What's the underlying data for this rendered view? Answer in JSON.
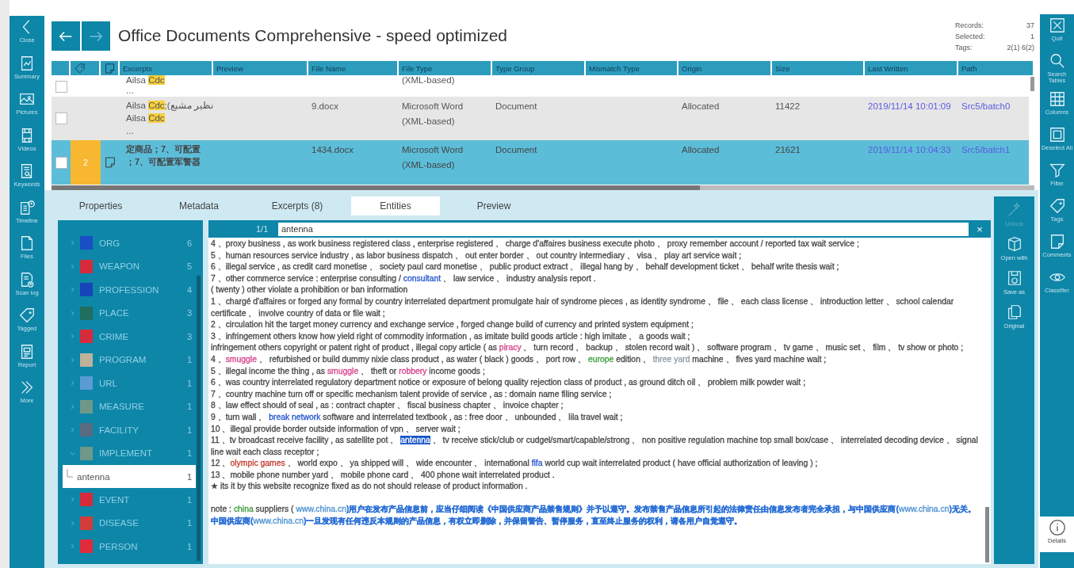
{
  "left_rail": [
    {
      "label": "Close"
    },
    {
      "label": "Summary"
    },
    {
      "label": "Pictures"
    },
    {
      "label": "Videos"
    },
    {
      "label": "Keywords"
    },
    {
      "label": "Timeline"
    },
    {
      "label": "Files"
    },
    {
      "label": "Scan log"
    },
    {
      "label": "Tagged"
    },
    {
      "label": "Report"
    },
    {
      "label": "More"
    }
  ],
  "nav": [
    {
      "kind": "back",
      "disabled": false
    },
    {
      "kind": "forward",
      "disabled": true
    }
  ],
  "title": "Office Documents Comprehensive - speed optimized",
  "stats": [
    {
      "label": "Records:",
      "value": "37"
    },
    {
      "label": "Selected:",
      "value": "1"
    },
    {
      "label": "Tags:",
      "value": "2(1) 6(2)"
    }
  ],
  "table": {
    "columns": [
      "Excerpts",
      "Preview",
      "File Name",
      "File Type",
      "Type Group",
      "Mismatch Type",
      "Origin",
      "Size",
      "Last Written",
      "Path"
    ],
    "rows": [
      {
        "checked": false,
        "selected": false,
        "note": false,
        "excerpt": [
          [
            {
              "text": "Ailsa "
            },
            {
              "text": "Cdc",
              "kind": "hit"
            }
          ],
          [
            {
              "text": "..."
            }
          ]
        ],
        "file_name": "",
        "file_type": "(XML-based)",
        "type_group": "",
        "origin": "",
        "size": "",
        "last_written": "",
        "path": ""
      },
      {
        "checked": false,
        "selected": false,
        "note": false,
        "excerpt": [
          [
            {
              "text": "Ailsa "
            },
            {
              "text": "Cdc",
              "kind": "hit"
            },
            {
              "text": ";(نظیر مشبع"
            }
          ],
          [
            {
              "text": "Ailsa "
            },
            {
              "text": "Cdc",
              "kind": "hit"
            }
          ],
          [
            {
              "text": "..."
            }
          ]
        ],
        "file_name": "9.docx",
        "file_type": "Microsoft Word (XML-based)",
        "type_group": "Document",
        "origin": "Allocated",
        "size": "11422",
        "last_written": "2019/11/14 10:01:09",
        "path": "Src5/batch0"
      },
      {
        "checked": false,
        "selected": true,
        "tag": "2",
        "note": true,
        "excerpt": [
          [
            {
              "text": "定商品；7、可配置"
            }
          ],
          [
            {
              "text": "；7、可配置军警器"
            }
          ]
        ],
        "file_name": "1434.docx",
        "file_type": "Microsoft Word (XML-based)",
        "type_group": "Document",
        "origin": "Allocated",
        "size": "21621",
        "last_written": "2019/11/14 10:04:33",
        "path": "Src5/batch1"
      }
    ]
  },
  "tabs": [
    {
      "label": "Properties",
      "selected": false
    },
    {
      "label": "Metadata",
      "selected": false
    },
    {
      "label": "Excerpts (8)",
      "selected": false
    },
    {
      "label": "Entities",
      "selected": true
    },
    {
      "label": "Preview",
      "selected": false
    }
  ],
  "entities": [
    {
      "name": "ORG",
      "count": "6",
      "color": "#1a4fc4",
      "expanded": false
    },
    {
      "name": "WEAPON",
      "count": "5",
      "color": "#d62b3a",
      "expanded": false
    },
    {
      "name": "PROFESSION",
      "count": "4",
      "color": "#1745b8",
      "expanded": false
    },
    {
      "name": "PLACE",
      "count": "3",
      "color": "#1f6e5e",
      "expanded": false
    },
    {
      "name": "CRIME",
      "count": "3",
      "color": "#d62b3a",
      "expanded": false
    },
    {
      "name": "PROGRAM",
      "count": "1",
      "color": "#bfb29a",
      "expanded": false
    },
    {
      "name": "URL",
      "count": "1",
      "color": "#5b9bd5",
      "expanded": false
    },
    {
      "name": "MEASURE",
      "count": "1",
      "color": "#6f978a",
      "expanded": false
    },
    {
      "name": "FACILITY",
      "count": "1",
      "color": "#5a6a80",
      "expanded": false
    },
    {
      "name": "IMPLEMENT",
      "count": "1",
      "color": "#6f978a",
      "expanded": true,
      "children": [
        {
          "name": "antenna",
          "count": "1",
          "selected": true
        }
      ]
    },
    {
      "name": "EVENT",
      "count": "1",
      "color": "#d62b3a",
      "expanded": false
    },
    {
      "name": "DISEASE",
      "count": "1",
      "color": "#d43b3b",
      "expanded": false
    },
    {
      "name": "PERSON",
      "count": "1",
      "color": "#e02b3a",
      "expanded": false
    }
  ],
  "search": {
    "counter": "1/1",
    "value": "antenna",
    "clear": "×"
  },
  "text_lines": [
    [
      {
        "text": "4 、proxy business , as work business registered class , enterprise registered 、 charge d'affaires business execute photo 、 proxy remember account / reported tax wait service ;"
      }
    ],
    [
      {
        "text": "5 、human resources service industry , as labor business dispatch 、 out enter border 、 out country intermediary 、 visa 、 play art service wait ;"
      }
    ],
    [
      {
        "text": "6 、illegal service , as credit card monetise 、 society paul card monetise 、 public product extract 、 illegal hang by 、 behalf development ticket 、 behalf write thesis wait ;"
      }
    ],
    [
      {
        "text": "7 、other commerce service : enterprise consulting / "
      },
      {
        "text": "consultant",
        "color": "#2255cc"
      },
      {
        "text": " 、 law service 、 industry analysis report ."
      }
    ],
    [
      {
        "text": "( twenty ) other violate a prohibition or ban information"
      }
    ],
    [
      {
        "text": "1 、chargé d'affaires or forged any formal by country interrelated department promulgate hair of syndrome pieces , as identity syndrome 、 file 、 each class license 、 introduction letter 、 school calendar certificate 、 involve country of data or file wait ;"
      }
    ],
    [
      {
        "text": "2 、circulation hit the target money currency and exchange service , forged change build of currency and printed system equipment ;"
      }
    ],
    [
      {
        "text": "3 、infringement others know how yield right of commodity information , as imitate build goods article : high imitate 、 a goods wait ;"
      }
    ],
    [
      {
        "text": "infringement others copyright or patent right of product , illegal copy article ( as "
      },
      {
        "text": "piracy",
        "color": "#d6408a"
      },
      {
        "text": " 、 turn record 、 backup 、 stolen record wait ) 、 software program 、 tv game 、 music set 、 film 、 tv show or photo ;"
      }
    ],
    [
      {
        "text": "4 、"
      },
      {
        "text": "smuggle",
        "color": "#d6408a"
      },
      {
        "text": " 、 refurbished or build dummy nixie class product , as water ( black ) goods 、 port row 、 "
      },
      {
        "text": "europe",
        "color": "#3a9a3a"
      },
      {
        "text": " edition 、 "
      },
      {
        "text": "three yard",
        "color": "#8a9aa8"
      },
      {
        "text": " machine 、 fives yard machine wait ;"
      }
    ],
    [
      {
        "text": "5 、illegal income the thing , as "
      },
      {
        "text": "smuggle",
        "color": "#d6408a"
      },
      {
        "text": " 、 theft or "
      },
      {
        "text": "robbery",
        "color": "#d6408a"
      },
      {
        "text": " income goods ;"
      }
    ],
    [
      {
        "text": "6 、was country interrelated regulatory department notice or exposure of belong quality rejection class of product , as ground ditch oil 、 problem milk powder wait ;"
      }
    ],
    [
      {
        "text": "7 、country machine turn off or specific mechanism talent provide of service , as : domain name filing service ;"
      }
    ],
    [
      {
        "text": "8 、law effect should of seal , as : contract chapter 、 fiscal business chapter 、 invoice chapter ;"
      }
    ],
    [
      {
        "text": "9 、turn wall 、 "
      },
      {
        "text": "break network",
        "color": "#2255cc"
      },
      {
        "text": " software and interrelated textbook , as : free door 、 unbounded 、 lila travel wait ;"
      }
    ],
    [
      {
        "text": "10 、illegal provide border outside information of vpn 、 server wait ;"
      }
    ],
    [
      {
        "text": "11 、tv broadcast receive facility , as satellite pot 、 "
      },
      {
        "text": "antenna",
        "kind": "match"
      },
      {
        "text": " 、 tv receive stick/club or cudgel/smart/capable/strong 、 non positive regulation machine top small box/case 、 interrelated decoding device 、 signal line wait each class receptor ;"
      }
    ],
    [
      {
        "text": "12 、"
      },
      {
        "text": "olympic games",
        "color": "#c0392b"
      },
      {
        "text": " 、 world expo 、 ya shipped will 、 wide encounter 、 international "
      },
      {
        "text": "fifa",
        "color": "#2255cc"
      },
      {
        "text": " world cup wait interrelated product ( have official authorization of leaving ) ;"
      }
    ],
    [
      {
        "text": "13 、mobile phone number yard 、 mobile phone card 、 400 phone wait interrelated product ."
      }
    ],
    [
      {
        "text": "★ its it by this website recognize fixed as do not should release of product information ."
      }
    ]
  ],
  "note": [
    {
      "text": "note : "
    },
    {
      "text": "china",
      "color": "#3a9a3a"
    },
    {
      "text": " suppliers ( "
    },
    {
      "text": "www.china.cn",
      "color": "#4a90d0"
    },
    {
      "text": ")用户在发布产品信息前，应当仔细阅读《中国供应商产品禁售规则》并予以遵守。发布禁售产品信息所引起的法律责任由信息发布者完全承担，与中国供应商(",
      "kind": "cjk"
    },
    {
      "text": "www.china.cn",
      "color": "#4a90d0"
    },
    {
      "text": ")无关。中国供应商(",
      "kind": "cjk"
    },
    {
      "text": "www.china.cn",
      "color": "#4a90d0"
    },
    {
      "text": ")一旦发现有任何违反本规则的产品信息，有权立即删除，并保留警告、暂停服务，直至终止服务的权利，请各用户自觉遵守。",
      "kind": "cjk"
    }
  ],
  "tools": [
    {
      "label": "Unlock",
      "disabled": true
    },
    {
      "label": "Open with",
      "disabled": false
    },
    {
      "label": "Save as",
      "disabled": false
    },
    {
      "label": "Original",
      "disabled": false
    }
  ],
  "right_rail": [
    {
      "label": "Quit"
    },
    {
      "label": "Search Tables"
    },
    {
      "label": "Columns"
    },
    {
      "label": "Deselect All"
    },
    {
      "label": "Filter"
    },
    {
      "label": "Tags"
    },
    {
      "label": "Comments"
    },
    {
      "label": "Classifier"
    }
  ],
  "details": {
    "label": "Details"
  }
}
